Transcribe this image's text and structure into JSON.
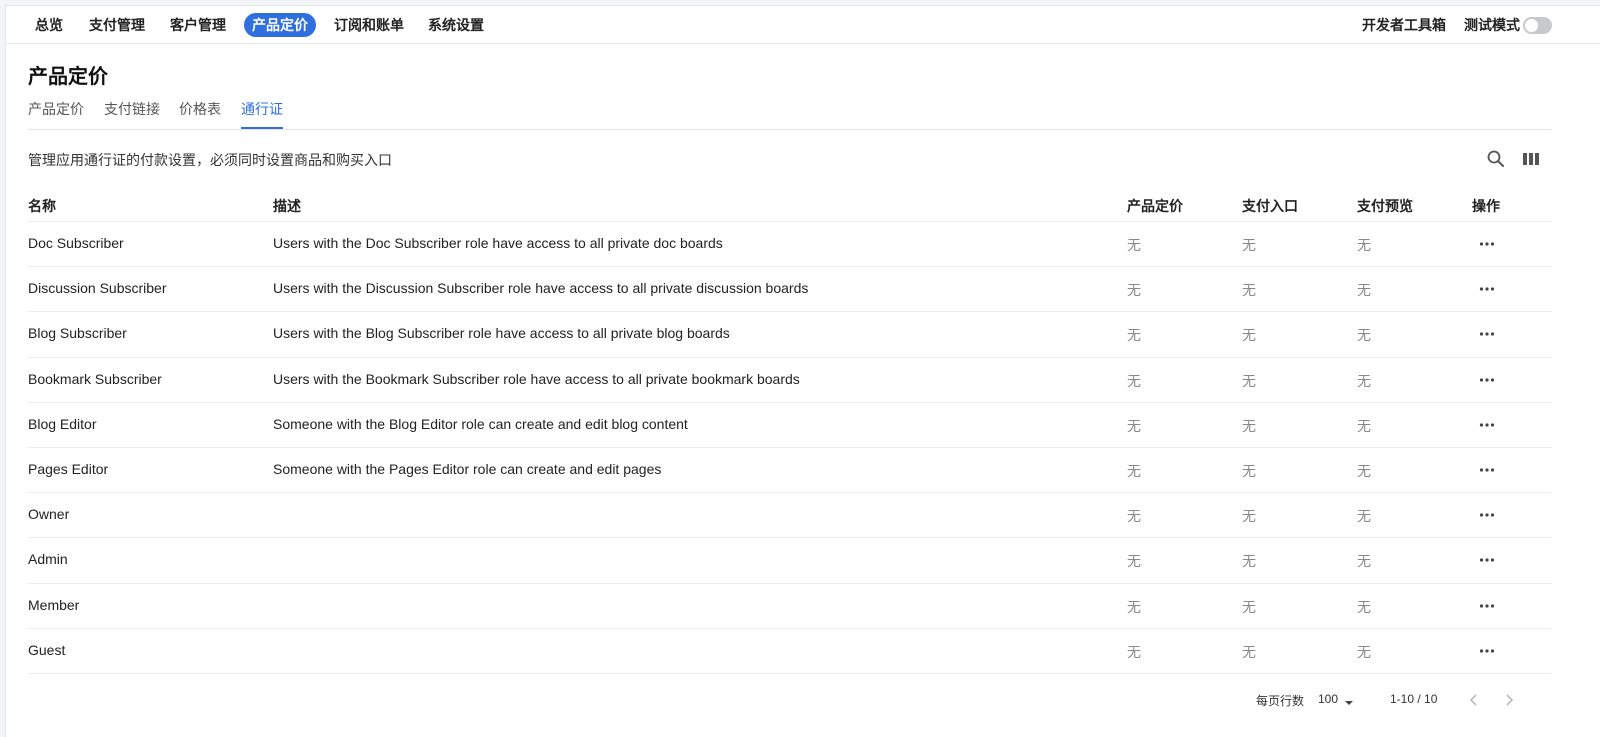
{
  "nav": {
    "items": [
      "总览",
      "支付管理",
      "客户管理",
      "产品定价",
      "订阅和账单",
      "系统设置"
    ],
    "active_index": 3,
    "devtools": "开发者工具箱",
    "test_mode": "测试模式"
  },
  "page": {
    "title": "产品定价",
    "tabs": [
      "产品定价",
      "支付链接",
      "价格表",
      "通行证"
    ],
    "active_tab_index": 3,
    "description": "管理应用通行证的付款设置，必须同时设置商品和购买入口"
  },
  "table": {
    "columns": [
      "名称",
      "描述",
      "产品定价",
      "支付入口",
      "支付预览",
      "操作"
    ],
    "rows": [
      {
        "name": "Doc Subscriber",
        "description": "Users with the Doc Subscriber role have access to all private doc boards",
        "pricing": "无",
        "entry": "无",
        "preview": "无"
      },
      {
        "name": "Discussion Subscriber",
        "description": "Users with the Discussion Subscriber role have access to all private discussion boards",
        "pricing": "无",
        "entry": "无",
        "preview": "无"
      },
      {
        "name": "Blog Subscriber",
        "description": "Users with the Blog Subscriber role have access to all private blog boards",
        "pricing": "无",
        "entry": "无",
        "preview": "无"
      },
      {
        "name": "Bookmark Subscriber",
        "description": "Users with the Bookmark Subscriber role have access to all private bookmark boards",
        "pricing": "无",
        "entry": "无",
        "preview": "无"
      },
      {
        "name": "Blog Editor",
        "description": "Someone with the Blog Editor role can create and edit blog content",
        "pricing": "无",
        "entry": "无",
        "preview": "无"
      },
      {
        "name": "Pages Editor",
        "description": "Someone with the Pages Editor role can create and edit pages",
        "pricing": "无",
        "entry": "无",
        "preview": "无"
      },
      {
        "name": "Owner",
        "description": "",
        "pricing": "无",
        "entry": "无",
        "preview": "无"
      },
      {
        "name": "Admin",
        "description": "",
        "pricing": "无",
        "entry": "无",
        "preview": "无"
      },
      {
        "name": "Member",
        "description": "",
        "pricing": "无",
        "entry": "无",
        "preview": "无"
      },
      {
        "name": "Guest",
        "description": "",
        "pricing": "无",
        "entry": "无",
        "preview": "无"
      }
    ]
  },
  "footer": {
    "rows_per_page_label": "每页行数",
    "rows_per_page_value": "100",
    "range": "1-10 / 10"
  },
  "icons": {
    "search": "search-icon",
    "columns": "columns-icon",
    "more": "more-horizontal-icon",
    "dropdown": "caret-down-icon",
    "prev": "chevron-left-icon",
    "next": "chevron-right-icon"
  },
  "colors": {
    "accent": "#2f6fe0",
    "toggle_off": "#c7c9cd",
    "muted_text": "#888888"
  }
}
